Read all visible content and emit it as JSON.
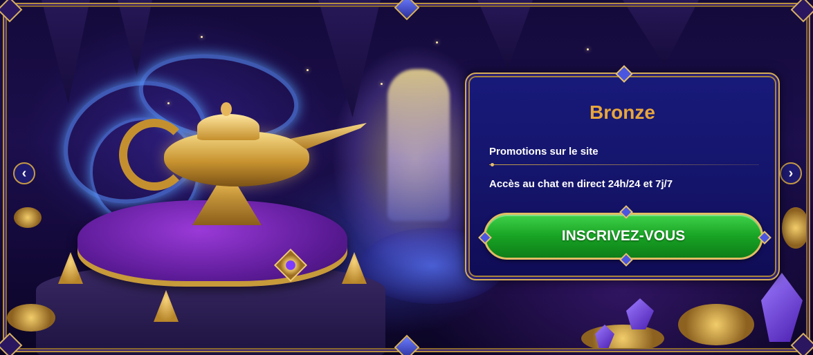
{
  "tier": {
    "title": "Bronze",
    "perks": [
      "Promotions sur le site",
      "Accès au chat en direct 24h/24 et 7j/7"
    ],
    "cta_label": "INSCRIVEZ-VOUS"
  },
  "nav": {
    "prev_icon": "‹",
    "next_icon": "›"
  },
  "colors": {
    "title": "#e8a63c",
    "cta": "#18a324",
    "frame": "#d6ac56",
    "card": "#14146a"
  }
}
